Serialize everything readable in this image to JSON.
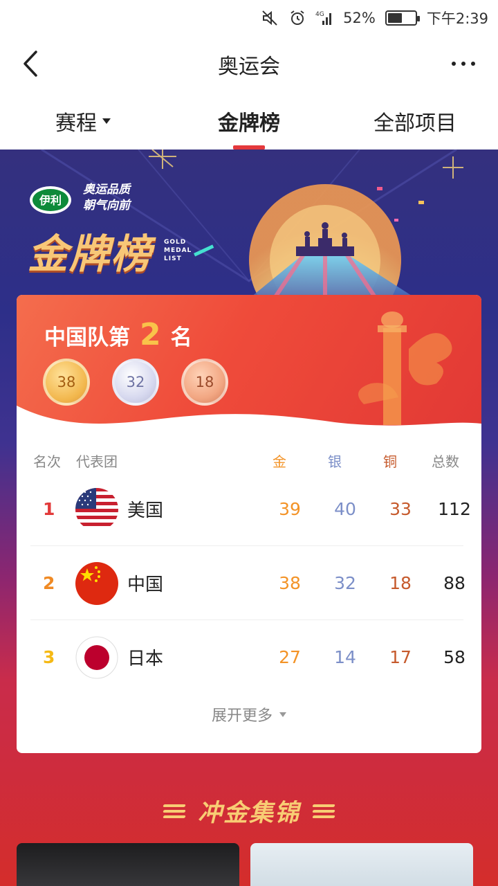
{
  "status_bar": {
    "battery_percent": "52%",
    "time": "下午2:39",
    "network": "4G",
    "battery_level": 0.52,
    "icons": [
      "mute-icon",
      "alarm-icon",
      "signal-icon",
      "battery-icon"
    ]
  },
  "header": {
    "title": "奥运会",
    "back_icon": "back-chevron-icon",
    "more_icon": "more-dots-icon"
  },
  "tabs": [
    {
      "label": "赛程",
      "active": false,
      "has_dropdown": true
    },
    {
      "label": "金牌榜",
      "active": true
    },
    {
      "label": "全部项目",
      "active": false
    }
  ],
  "banner": {
    "brand_logo": "伊利",
    "slogan_line1": "奥运品质",
    "slogan_line2": "朝气向前",
    "title": "金牌榜",
    "subtitle_line1": "GOLD",
    "subtitle_line2": "MEDAL",
    "subtitle_line3": "LIST"
  },
  "china_summary": {
    "prefix": "中国队第",
    "rank": "2",
    "suffix": "名",
    "gold": "38",
    "silver": "32",
    "bronze": "18"
  },
  "table": {
    "headers": {
      "rank": "名次",
      "team": "代表团",
      "gold": "金",
      "silver": "银",
      "bronze": "铜",
      "total": "总数"
    },
    "rows": [
      {
        "rank": "1",
        "country": "美国",
        "flag": "usa-flag-icon",
        "gold": "39",
        "silver": "40",
        "bronze": "33",
        "total": "112",
        "rank_color": "#e23a3a"
      },
      {
        "rank": "2",
        "country": "中国",
        "flag": "china-flag-icon",
        "gold": "38",
        "silver": "32",
        "bronze": "18",
        "total": "88",
        "rank_color": "#f08a24"
      },
      {
        "rank": "3",
        "country": "日本",
        "flag": "japan-flag-icon",
        "gold": "27",
        "silver": "14",
        "bronze": "17",
        "total": "58",
        "rank_color": "#f5b915"
      }
    ],
    "expand_label": "展开更多"
  },
  "section": {
    "title": "冲金集锦"
  },
  "colors": {
    "accent_red": "#e4393c",
    "gold_text": "#f39327",
    "silver_text": "#7c8fc8",
    "bronze_text": "#c65a2c"
  }
}
